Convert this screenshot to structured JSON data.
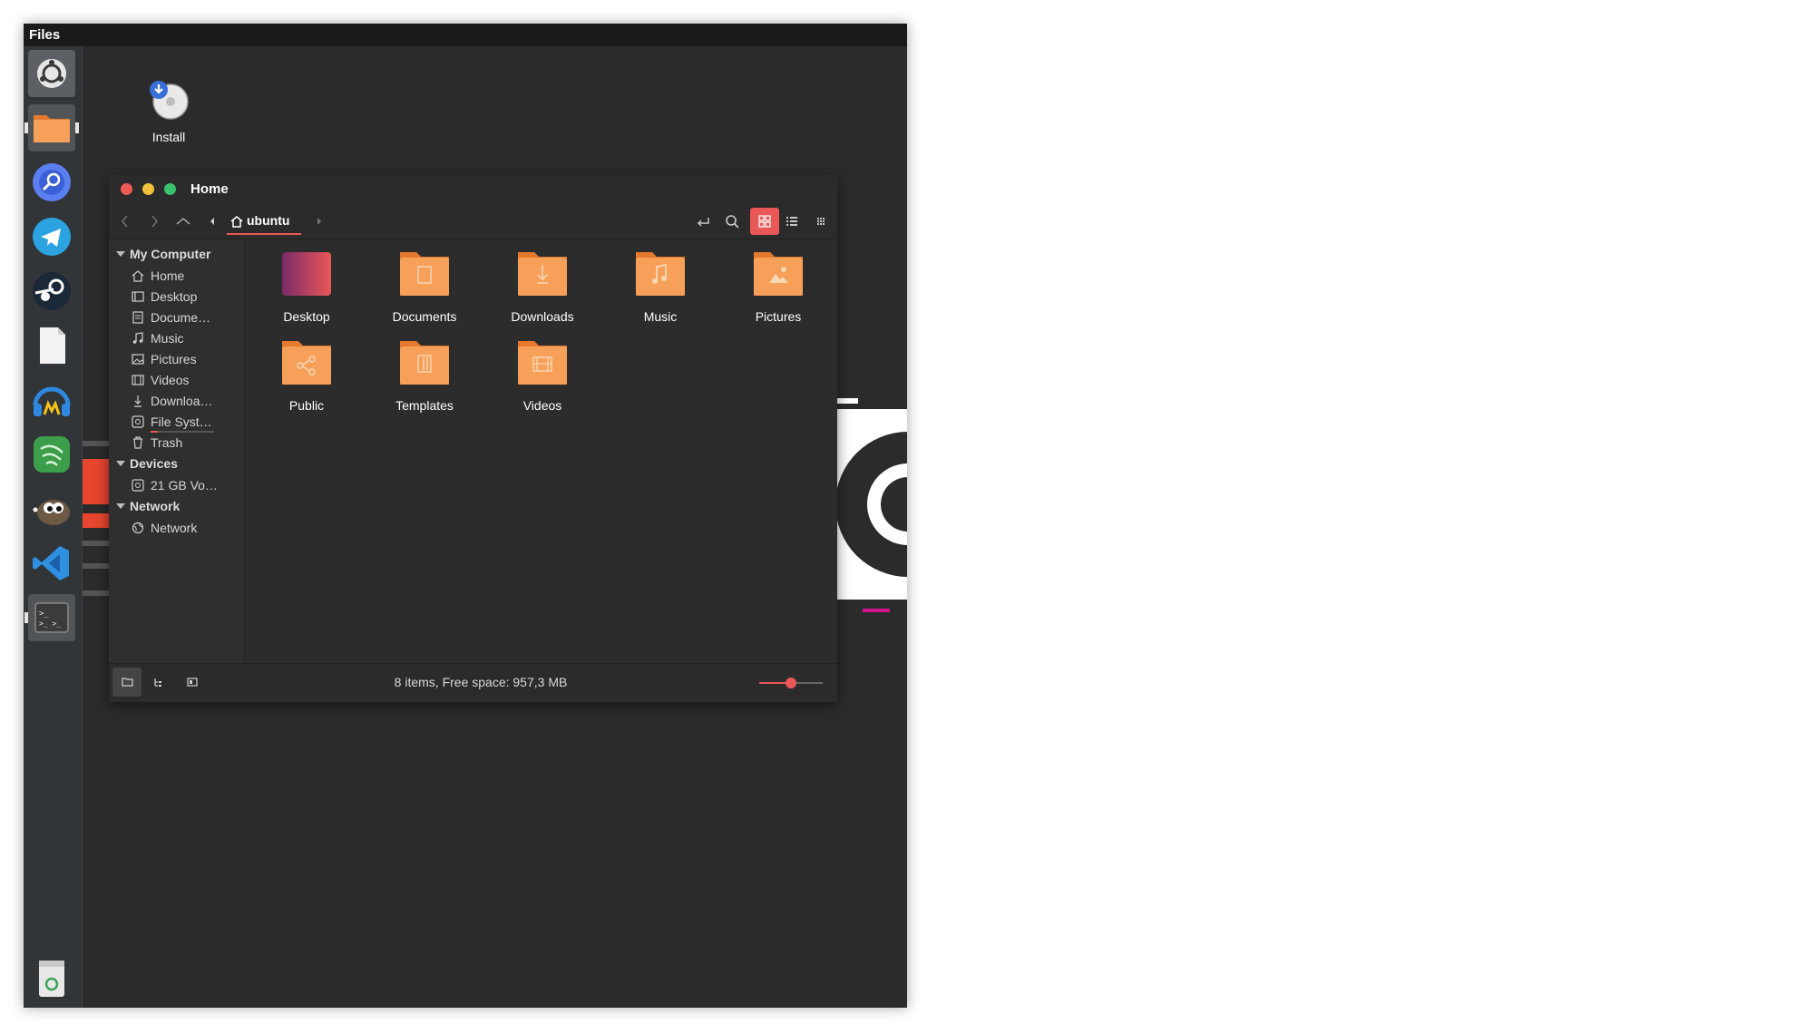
{
  "topbar": {
    "title": "Files"
  },
  "launcher": {
    "apps": [
      {
        "name": "Ubuntu Settings",
        "icon": "ubuntu-logo-icon"
      },
      {
        "name": "Files",
        "icon": "folder-icon",
        "active": true
      },
      {
        "name": "Web Browser",
        "icon": "browser-icon"
      },
      {
        "name": "Telegram",
        "icon": "telegram-icon"
      },
      {
        "name": "Steam",
        "icon": "steam-icon"
      },
      {
        "name": "Text Editor",
        "icon": "document-icon"
      },
      {
        "name": "Audacious",
        "icon": "headphones-icon"
      },
      {
        "name": "Green App",
        "icon": "green-app-icon"
      },
      {
        "name": "GIMP",
        "icon": "gimp-icon"
      },
      {
        "name": "VS Code",
        "icon": "vscode-icon"
      },
      {
        "name": "Terminal",
        "icon": "terminal-icon"
      },
      {
        "name": "Trash",
        "icon": "trash-icon"
      }
    ]
  },
  "desktop": {
    "icons": [
      {
        "label": "Install",
        "icon": "install-disk-icon"
      }
    ]
  },
  "window": {
    "title": "Home",
    "toolbar": {
      "back": "back-icon",
      "forward": "forward-icon",
      "up": "up-icon",
      "breadcrumb": "ubuntu",
      "buttons": [
        "toggle-location-icon",
        "search-icon",
        "icon-view-icon",
        "list-view-icon",
        "compact-view-icon"
      ]
    },
    "sidebar": {
      "sections": [
        {
          "title": "My Computer",
          "items": [
            "Home",
            "Desktop",
            "Docume…",
            "Music",
            "Pictures",
            "Videos",
            "Downloa…",
            "File Syst…",
            "Trash"
          ]
        },
        {
          "title": "Devices",
          "items": [
            "21 GB Vo…"
          ]
        },
        {
          "title": "Network",
          "items": [
            "Network"
          ]
        }
      ]
    },
    "files": [
      "Desktop",
      "Documents",
      "Downloads",
      "Music",
      "Pictures",
      "Public",
      "Templates",
      "Videos"
    ],
    "status": {
      "text": "8 items, Free space: 957,3 MB",
      "zoom": 0.5
    }
  },
  "colors": {
    "accent": "#e95756",
    "folder": "#f48f4e",
    "panel": "#2b2b2b"
  }
}
